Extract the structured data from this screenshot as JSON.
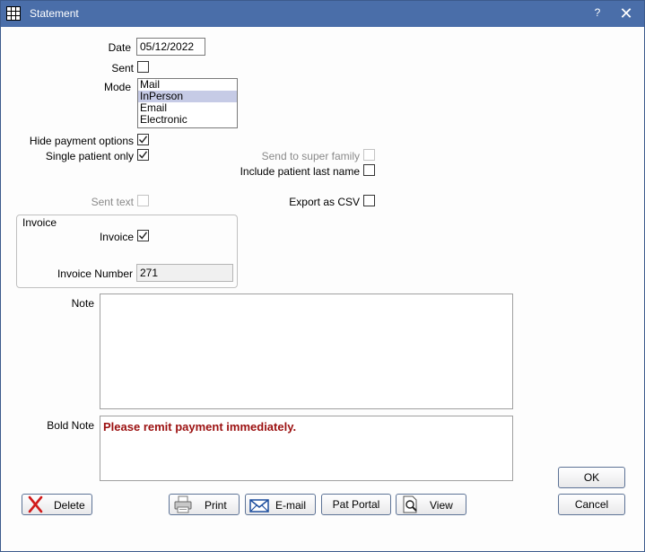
{
  "window": {
    "title": "Statement",
    "help_label": "?",
    "close_label": "✕"
  },
  "form": {
    "date_label": "Date",
    "date_value": "05/12/2022",
    "sent_label": "Sent",
    "sent_checked": false,
    "mode_label": "Mode",
    "mode_options": [
      "Mail",
      "InPerson",
      "Email",
      "Electronic"
    ],
    "mode_selected": "InPerson",
    "hide_payment_label": "Hide payment options",
    "hide_payment_checked": true,
    "single_patient_label": "Single patient only",
    "single_patient_checked": true,
    "super_family_label": "Send to super family",
    "super_family_checked": false,
    "include_last_name_label": "Include patient last name",
    "include_last_name_checked": false,
    "sent_text_label": "Sent text",
    "sent_text_checked": false,
    "export_csv_label": "Export as CSV",
    "export_csv_checked": false
  },
  "invoice": {
    "group_title": "Invoice",
    "invoice_label": "Invoice",
    "invoice_checked": true,
    "number_label": "Invoice Number",
    "number_value": "271"
  },
  "notes": {
    "note_label": "Note",
    "note_value": "",
    "bold_note_label": "Bold Note",
    "bold_note_value": "Please remit payment immediately.",
    "bold_note_color": "#9b1010"
  },
  "buttons": {
    "delete": "Delete",
    "print": "Print",
    "email": "E-mail",
    "pat_portal": "Pat Portal",
    "view": "View",
    "ok": "OK",
    "cancel": "Cancel"
  },
  "colors": {
    "titlebar": "#4a6ea9",
    "selection": "#c6cbe6"
  }
}
